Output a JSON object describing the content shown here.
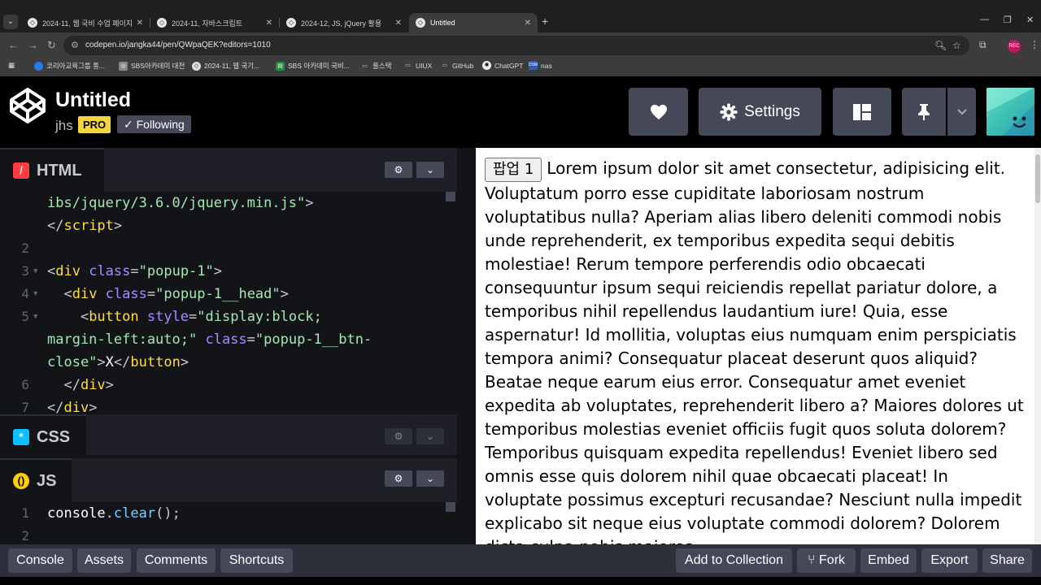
{
  "browser": {
    "tabs": [
      {
        "label": "2024-11, 웹 국비 수업 페이지",
        "active": false
      },
      {
        "label": "2024-11, 자바스크립트",
        "active": false
      },
      {
        "label": "2024-12, JS, jQuery 활용",
        "active": false
      },
      {
        "label": "Untitled",
        "active": true
      }
    ],
    "url": "codepen.io/jangka44/pen/QWpaQEK?editors=1010",
    "profile_label": "REC",
    "bookmarks": [
      {
        "label": "코리아교육그룹 통...",
        "icon": "bookmark-site-icon"
      },
      {
        "label": "SBS아카데미 대전",
        "icon": "bookmark-site-icon"
      },
      {
        "label": "2024-11, 웹 국기...",
        "icon": "bookmark-site-icon"
      },
      {
        "label": "SBS 아카데미 국비...",
        "icon": "sheets-icon"
      },
      {
        "label": "풀스택",
        "icon": "folder-icon"
      },
      {
        "label": "UIUX",
        "icon": "folder-icon"
      },
      {
        "label": "GitHub",
        "icon": "folder-icon"
      },
      {
        "label": "ChatGPT",
        "icon": "chatgpt-icon"
      },
      {
        "label": "nas",
        "icon": "synology-icon"
      }
    ]
  },
  "header": {
    "title": "Untitled",
    "author": "jhs",
    "pro": "PRO",
    "following": "Following",
    "settings_label": "Settings"
  },
  "editors": {
    "html": {
      "label": "HTML",
      "lines": [
        {
          "num": "",
          "fold": false,
          "tokens": [
            {
              "t": "ibs/jquery/3.6.0/jquery.min.js\"",
              "c": "t-str"
            },
            {
              "t": ">",
              "c": "t-punc"
            }
          ]
        },
        {
          "num": "",
          "fold": false,
          "tokens": [
            {
              "t": "</",
              "c": "t-punc"
            },
            {
              "t": "script",
              "c": "t-tag"
            },
            {
              "t": ">",
              "c": "t-punc"
            }
          ]
        },
        {
          "num": "2",
          "fold": false,
          "tokens": []
        },
        {
          "num": "3",
          "fold": true,
          "tokens": [
            {
              "t": "<",
              "c": "t-punc"
            },
            {
              "t": "div",
              "c": "t-tag"
            },
            {
              "t": " class",
              "c": "t-attr"
            },
            {
              "t": "=",
              "c": "t-punc"
            },
            {
              "t": "\"popup-1\"",
              "c": "t-str"
            },
            {
              "t": ">",
              "c": "t-punc"
            }
          ]
        },
        {
          "num": "4",
          "fold": true,
          "tokens": [
            {
              "t": "  <",
              "c": "t-punc"
            },
            {
              "t": "div",
              "c": "t-tag"
            },
            {
              "t": " class",
              "c": "t-attr"
            },
            {
              "t": "=",
              "c": "t-punc"
            },
            {
              "t": "\"popup-1__head\"",
              "c": "t-str"
            },
            {
              "t": ">",
              "c": "t-punc"
            }
          ]
        },
        {
          "num": "5",
          "fold": true,
          "tokens": [
            {
              "t": "    <",
              "c": "t-punc"
            },
            {
              "t": "button",
              "c": "t-tag"
            },
            {
              "t": " style",
              "c": "t-attr"
            },
            {
              "t": "=",
              "c": "t-punc"
            },
            {
              "t": "\"display:block;",
              "c": "t-str"
            }
          ]
        },
        {
          "num": "",
          "fold": false,
          "tokens": [
            {
              "t": "margin-left:auto;\"",
              "c": "t-str"
            },
            {
              "t": " class",
              "c": "t-attr"
            },
            {
              "t": "=",
              "c": "t-punc"
            },
            {
              "t": "\"popup-1__btn-",
              "c": "t-str"
            }
          ]
        },
        {
          "num": "",
          "fold": false,
          "tokens": [
            {
              "t": "close\"",
              "c": "t-str"
            },
            {
              "t": ">",
              "c": "t-punc"
            },
            {
              "t": "X",
              "c": ""
            },
            {
              "t": "</",
              "c": "t-punc"
            },
            {
              "t": "button",
              "c": "t-tag"
            },
            {
              "t": ">",
              "c": "t-punc"
            }
          ]
        },
        {
          "num": "6",
          "fold": false,
          "tokens": [
            {
              "t": "  </",
              "c": "t-punc"
            },
            {
              "t": "div",
              "c": "t-tag"
            },
            {
              "t": ">",
              "c": "t-punc"
            }
          ]
        },
        {
          "num": "7",
          "fold": false,
          "tokens": [
            {
              "t": "</",
              "c": "t-punc"
            },
            {
              "t": "div",
              "c": "t-tag"
            },
            {
              "t": ">",
              "c": "t-punc"
            }
          ]
        }
      ]
    },
    "css": {
      "label": "CSS"
    },
    "js": {
      "label": "JS",
      "lines": [
        {
          "num": "1",
          "fold": false,
          "tokens": [
            {
              "t": "console",
              "c": ""
            },
            {
              "t": ".",
              "c": "t-punc"
            },
            {
              "t": "clear",
              "c": "t-fn"
            },
            {
              "t": "();",
              "c": "t-punc"
            }
          ]
        },
        {
          "num": "2",
          "fold": false,
          "tokens": []
        }
      ]
    }
  },
  "preview": {
    "button_label": "팝업 1",
    "text": "Lorem ipsum dolor sit amet consectetur, adipisicing elit. Voluptatum porro esse cupiditate laboriosam nostrum voluptatibus nulla? Aperiam alias libero deleniti commodi nobis unde reprehenderit, ex temporibus expedita sequi debitis molestiae! Rerum tempore perferendis odio obcaecati consequuntur ipsum sequi reiciendis repellat pariatur dolore, a temporibus nihil repellendus laudantium iure! Quia, esse aspernatur! Id mollitia, voluptas eius numquam enim perspiciatis tempora animi? Consequatur placeat deserunt quos aliquid? Beatae neque earum eius error. Consequatur amet eveniet expedita ab voluptates, reprehenderit libero a? Maiores dolores ut temporibus molestias eveniet officiis fugit quos soluta dolorem? Temporibus quisquam expedita repellendus! Eveniet libero sed omnis esse quis dolorem nihil quae obcaecati placeat! In voluptate possimus excepturi recusandae? Nesciunt nulla impedit explicabo sit neque eius voluptate commodi dolorem? Dolorem dicta culpa nobis maiores"
  },
  "footer": {
    "console": "Console",
    "assets": "Assets",
    "comments": "Comments",
    "shortcuts": "Shortcuts",
    "add_to_collection": "Add to Collection",
    "fork": "Fork",
    "embed": "Embed",
    "export": "Export",
    "share": "Share"
  },
  "colors": {
    "html_icon": "#ff3c41",
    "css_icon": "#0ebeff",
    "js_icon": "#fcd000",
    "pro_badge": "#f5d53d"
  }
}
